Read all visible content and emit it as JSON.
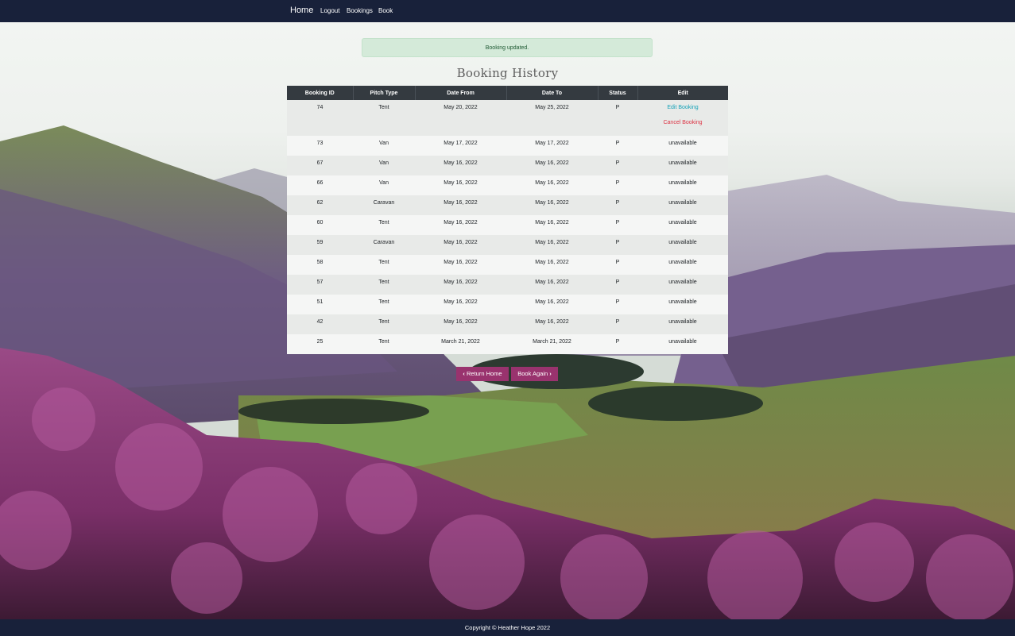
{
  "nav": {
    "brand": "Home",
    "links": [
      "Logout",
      "Bookings",
      "Book"
    ]
  },
  "alert": "Booking updated.",
  "page_title": "Booking History",
  "table": {
    "headers": [
      "Booking ID",
      "Pitch Type",
      "Date From",
      "Date To",
      "Status",
      "Edit"
    ],
    "first_row": {
      "id": "74",
      "pitch": "Tent",
      "from": "May 20, 2022",
      "to": "May 25, 2022",
      "status": "P",
      "edit_label": "Edit Booking",
      "cancel_label": "Cancel Booking"
    },
    "rows": [
      [
        "73",
        "Van",
        "May 17, 2022",
        "May 17, 2022",
        "P",
        "unavailable"
      ],
      [
        "67",
        "Van",
        "May 16, 2022",
        "May 16, 2022",
        "P",
        "unavailable"
      ],
      [
        "66",
        "Van",
        "May 16, 2022",
        "May 16, 2022",
        "P",
        "unavailable"
      ],
      [
        "62",
        "Caravan",
        "May 16, 2022",
        "May 16, 2022",
        "P",
        "unavailable"
      ],
      [
        "60",
        "Tent",
        "May 16, 2022",
        "May 16, 2022",
        "P",
        "unavailable"
      ],
      [
        "59",
        "Caravan",
        "May 16, 2022",
        "May 16, 2022",
        "P",
        "unavailable"
      ],
      [
        "58",
        "Tent",
        "May 16, 2022",
        "May 16, 2022",
        "P",
        "unavailable"
      ],
      [
        "57",
        "Tent",
        "May 16, 2022",
        "May 16, 2022",
        "P",
        "unavailable"
      ],
      [
        "51",
        "Tent",
        "May 16, 2022",
        "May 16, 2022",
        "P",
        "unavailable"
      ],
      [
        "42",
        "Tent",
        "May 16, 2022",
        "May 16, 2022",
        "P",
        "unavailable"
      ],
      [
        "25",
        "Tent",
        "March 21, 2022",
        "March 21, 2022",
        "P",
        "unavailable"
      ]
    ]
  },
  "buttons": {
    "return_home": "Return Home",
    "book_again": "Book Again",
    "left_icon": "chevron-left-icon",
    "right_icon": "chevron-right-icon"
  },
  "footer": "Copyright © Heather Hope 2022",
  "colors": {
    "navbar": "#18213a",
    "table_header": "#343a40",
    "button": "#99336e",
    "edit_link": "#17a2b8",
    "cancel_link": "#dc3545",
    "alert_bg": "#d4ead9"
  }
}
